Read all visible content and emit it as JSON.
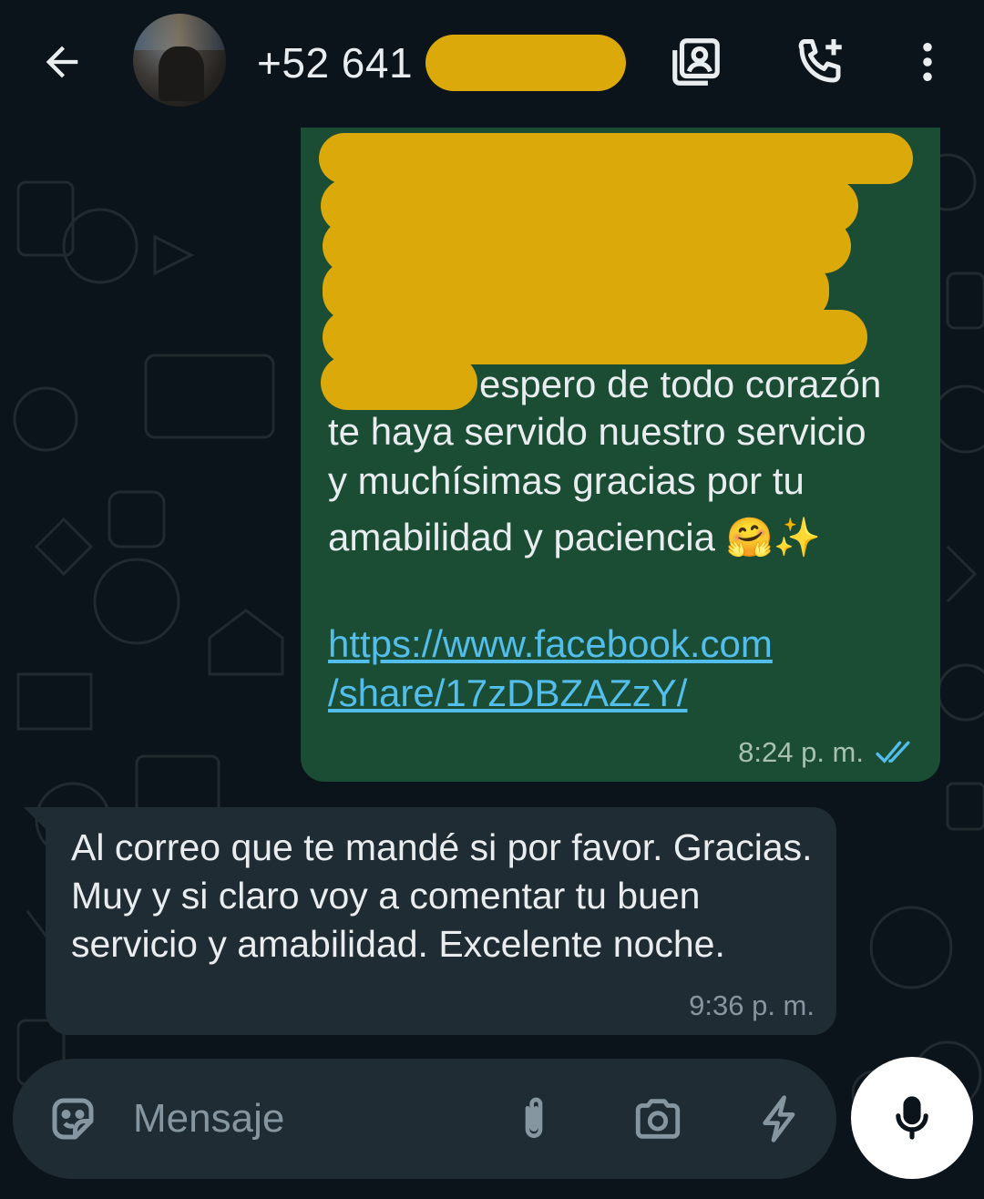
{
  "header": {
    "contact_number": "+52 641",
    "back_icon": "arrow-left-icon",
    "contact_card_icon": "contact-card-icon",
    "add_call_icon": "add-call-icon",
    "menu_icon": "more-vert-icon"
  },
  "messages": {
    "outgoing": {
      "lines": [
        "espero de todo corazón",
        "te haya servido nuestro servicio",
        "y muchísimas gracias por tu",
        "amabilidad y paciencia 🤗✨"
      ],
      "link_lines": [
        "https://www.facebook.com",
        "/share/17zDBZAZzY/"
      ],
      "time": "8:24 p. m.",
      "status_icon": "double-check-icon"
    },
    "incoming": {
      "text": "Al correo que te mandé si por favor. Gracias.  Muy y si claro voy a comentar tu buen servicio y amabilidad. Excelente noche.",
      "time": "9:36 p. m."
    }
  },
  "composer": {
    "placeholder": "Mensaje",
    "emoji_icon": "sticker-icon",
    "attach_icon": "paperclip-icon",
    "camera_icon": "camera-icon",
    "quick_reply_icon": "lightning-icon",
    "mic_icon": "microphone-icon"
  },
  "colors": {
    "background": "#0b141a",
    "outgoing_bubble": "#1a4d33",
    "incoming_bubble": "#202c33",
    "link": "#53bdeb",
    "read_ticks": "#53bdeb",
    "redaction": "#dca90a"
  }
}
